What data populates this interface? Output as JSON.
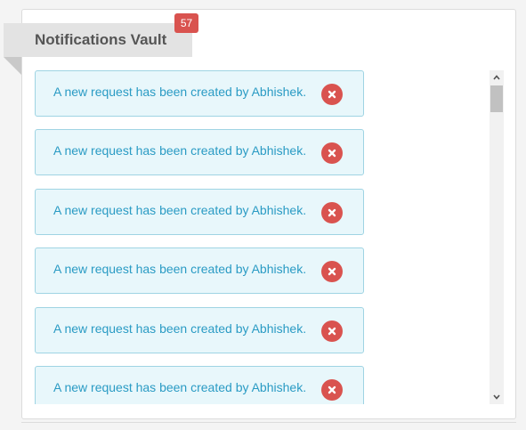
{
  "header": {
    "title": "Notifications Vault",
    "badge_count": "57"
  },
  "notifications": [
    {
      "text": "A new request has been created by Abhishek.",
      "dismiss_icon": "close-circle-icon"
    },
    {
      "text": "A new request has been created by Abhishek.",
      "dismiss_icon": "close-circle-icon"
    },
    {
      "text": "A new request has been created by Abhishek.",
      "dismiss_icon": "close-circle-icon"
    },
    {
      "text": "A new request has been created by Abhishek.",
      "dismiss_icon": "close-circle-icon"
    },
    {
      "text": "A new request has been created by Abhishek.",
      "dismiss_icon": "close-circle-icon"
    },
    {
      "text": "A new request has been created by Abhishek.",
      "dismiss_icon": "close-circle-icon"
    }
  ],
  "colors": {
    "alert_background": "#e8f7fb",
    "alert_border": "#9fd4e3",
    "alert_text": "#2a9bc4",
    "badge": "#d9534f",
    "dismiss_button": "#d9534f",
    "ribbon": "#e3e3e3"
  }
}
